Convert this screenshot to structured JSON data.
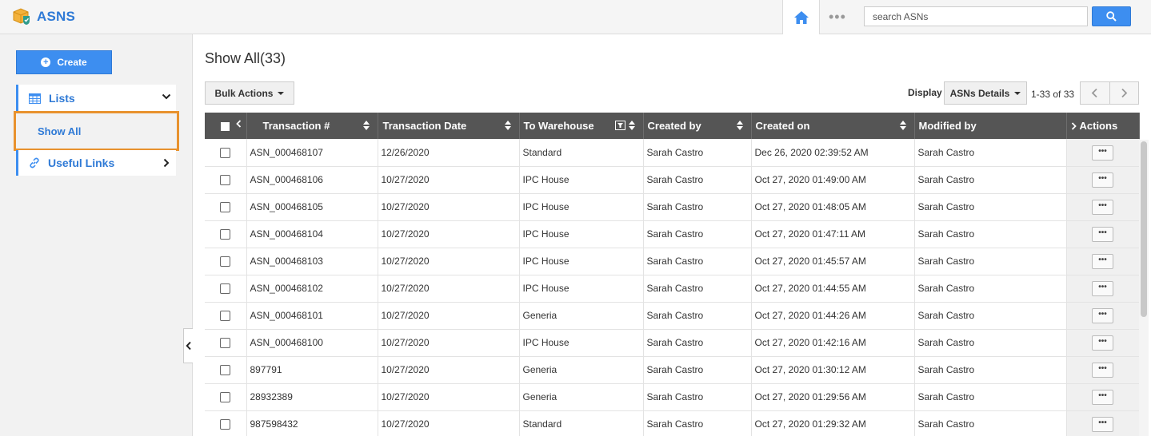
{
  "app": {
    "title": "ASNS",
    "colors": {
      "accent": "#3d8ef0",
      "highlight": "#e8922e",
      "header": "#555555"
    }
  },
  "topbar": {
    "home_icon": "home-icon",
    "more_label": "•••",
    "search_placeholder": "search ASNs",
    "search_icon": "search-icon"
  },
  "sidebar": {
    "create_label": "Create",
    "lists_label": "Lists",
    "show_all_label": "Show All",
    "useful_links_label": "Useful Links"
  },
  "main": {
    "title": "Show All(33)",
    "bulk_actions_label": "Bulk Actions",
    "display_label": "Display",
    "display_value": "ASNs Details",
    "page_count": "1-33 of 33"
  },
  "table": {
    "columns": [
      "Transaction #",
      "Transaction Date",
      "To Warehouse",
      "Created by",
      "Created on",
      "Modified by",
      "Actions"
    ],
    "rows": [
      [
        "ASN_000468107",
        "12/26/2020",
        "Standard",
        "Sarah Castro",
        "Dec 26, 2020 02:39:52 AM",
        "Sarah Castro"
      ],
      [
        "ASN_000468106",
        "10/27/2020",
        "IPC House",
        "Sarah Castro",
        "Oct 27, 2020 01:49:00 AM",
        "Sarah Castro"
      ],
      [
        "ASN_000468105",
        "10/27/2020",
        "IPC House",
        "Sarah Castro",
        "Oct 27, 2020 01:48:05 AM",
        "Sarah Castro"
      ],
      [
        "ASN_000468104",
        "10/27/2020",
        "IPC House",
        "Sarah Castro",
        "Oct 27, 2020 01:47:11 AM",
        "Sarah Castro"
      ],
      [
        "ASN_000468103",
        "10/27/2020",
        "IPC House",
        "Sarah Castro",
        "Oct 27, 2020 01:45:57 AM",
        "Sarah Castro"
      ],
      [
        "ASN_000468102",
        "10/27/2020",
        "IPC House",
        "Sarah Castro",
        "Oct 27, 2020 01:44:55 AM",
        "Sarah Castro"
      ],
      [
        "ASN_000468101",
        "10/27/2020",
        "Generia",
        "Sarah Castro",
        "Oct 27, 2020 01:44:26 AM",
        "Sarah Castro"
      ],
      [
        "ASN_000468100",
        "10/27/2020",
        "IPC House",
        "Sarah Castro",
        "Oct 27, 2020 01:42:16 AM",
        "Sarah Castro"
      ],
      [
        "897791",
        "10/27/2020",
        "Generia",
        "Sarah Castro",
        "Oct 27, 2020 01:30:12 AM",
        "Sarah Castro"
      ],
      [
        "28932389",
        "10/27/2020",
        "Generia",
        "Sarah Castro",
        "Oct 27, 2020 01:29:56 AM",
        "Sarah Castro"
      ],
      [
        "987598432",
        "10/27/2020",
        "Standard",
        "Sarah Castro",
        "Oct 27, 2020 01:29:32 AM",
        "Sarah Castro"
      ]
    ],
    "row_action_label": "•••"
  }
}
